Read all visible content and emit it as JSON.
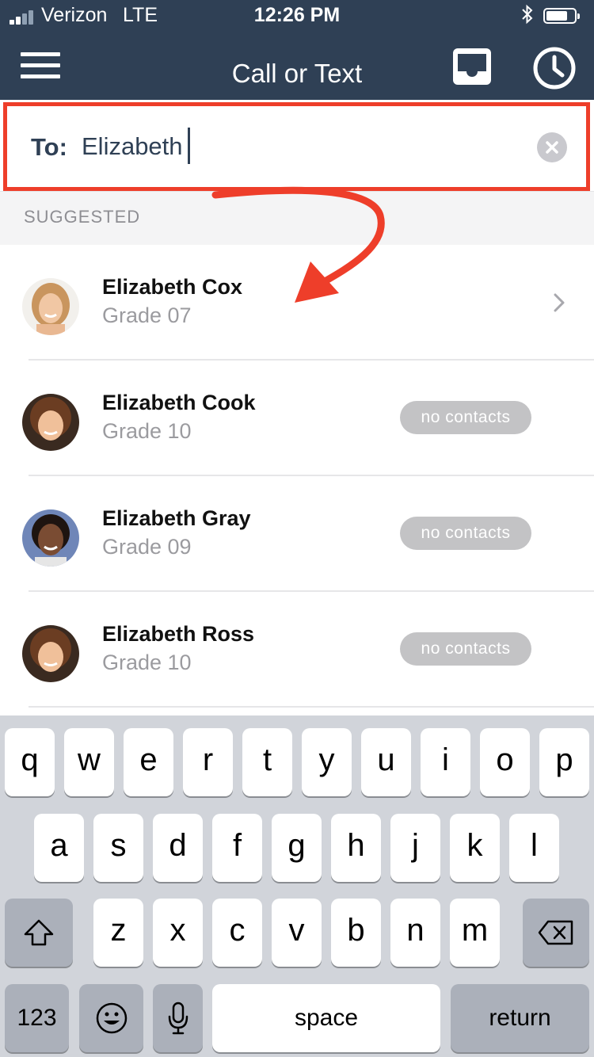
{
  "status_bar": {
    "carrier": "Verizon",
    "network": "LTE",
    "time": "12:26 PM"
  },
  "nav": {
    "title": "Call or Text",
    "menu_icon": "hamburger-menu-icon",
    "inbox_icon": "inbox-tray-icon",
    "history_icon": "clock-icon"
  },
  "to_field": {
    "label": "To:",
    "value": "Elizabeth",
    "clear_icon": "clear-x-icon"
  },
  "section_header": "SUGGESTED",
  "results": [
    {
      "name": "Elizabeth Cox",
      "grade": "Grade 07",
      "badge": "",
      "chevron": true
    },
    {
      "name": "Elizabeth Cook",
      "grade": "Grade 10",
      "badge": "no contacts",
      "chevron": false
    },
    {
      "name": "Elizabeth Gray",
      "grade": "Grade 09",
      "badge": "no contacts",
      "chevron": false
    },
    {
      "name": "Elizabeth Ross",
      "grade": "Grade 10",
      "badge": "no contacts",
      "chevron": false
    }
  ],
  "annotation": {
    "color": "#ee3e2a"
  },
  "colors": {
    "nav_background": "#2f4055",
    "highlight_border": "#ee3e2a",
    "badge_background": "#c3c3c5",
    "keyboard_background": "#d1d4da"
  },
  "keyboard": {
    "row1": [
      "q",
      "w",
      "e",
      "r",
      "t",
      "y",
      "u",
      "i",
      "o",
      "p"
    ],
    "row2": [
      "a",
      "s",
      "d",
      "f",
      "g",
      "h",
      "j",
      "k",
      "l"
    ],
    "row3": [
      "z",
      "x",
      "c",
      "v",
      "b",
      "n",
      "m"
    ],
    "numbers_key": "123",
    "space_key": "space",
    "return_key": "return",
    "shift_icon": "shift-arrow-icon",
    "backspace_icon": "backspace-icon",
    "emoji_icon": "emoji-icon",
    "mic_icon": "microphone-icon"
  }
}
